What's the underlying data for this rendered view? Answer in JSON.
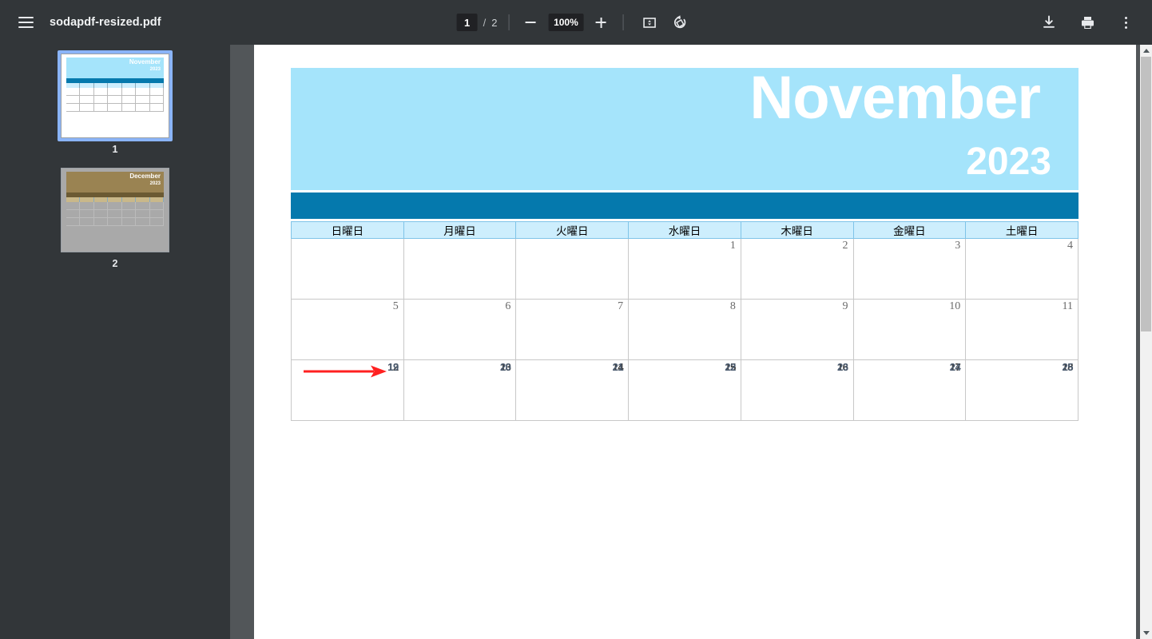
{
  "toolbar": {
    "menu_icon": "hamburger-menu-icon",
    "document_title": "sodapdf-resized.pdf",
    "page_current": "1",
    "page_separator": "/",
    "page_total": "2",
    "zoom_out_icon": "minus-icon",
    "zoom_level": "100%",
    "zoom_in_icon": "plus-icon",
    "fit_page_icon": "fit-to-page-icon",
    "rotate_icon": "rotate-counterclockwise-icon",
    "download_icon": "download-icon",
    "print_icon": "print-icon",
    "more_icon": "more-options-icon"
  },
  "sidebar": {
    "thumbnails": [
      {
        "label": "1",
        "month": "November",
        "year": "2023",
        "selected": true
      },
      {
        "label": "2",
        "month": "December",
        "year": "2023",
        "selected": false
      }
    ]
  },
  "document": {
    "calendar": {
      "month": "November",
      "year": "2023",
      "banner_color": "#a5e4fb",
      "bar_color": "#0579ad",
      "header_color": "#cdeefd",
      "weekdays": [
        "日曜日",
        "月曜日",
        "火曜日",
        "水曜日",
        "木曜日",
        "金曜日",
        "土曜日"
      ],
      "weeks": [
        [
          "",
          "",
          "",
          "1",
          "2",
          "3",
          "4"
        ],
        [
          "5",
          "6",
          "7",
          "8",
          "9",
          "10",
          "11"
        ],
        [
          "12",
          "13",
          "14",
          "15",
          "16",
          "17",
          "18"
        ]
      ],
      "overlap_weeks": [
        [
          "",
          "",
          "",
          "",
          "",
          "",
          ""
        ],
        [
          "",
          "",
          "",
          "",
          "",
          "",
          ""
        ],
        [
          "19",
          "20",
          "21",
          "22",
          "23",
          "24",
          "25"
        ]
      ]
    },
    "annotation": {
      "type": "red-arrow",
      "color": "#ff2020",
      "direction": "right"
    }
  },
  "scrollbar": {
    "up_icon": "scroll-up-arrow-icon",
    "down_icon": "scroll-down-arrow-icon"
  }
}
